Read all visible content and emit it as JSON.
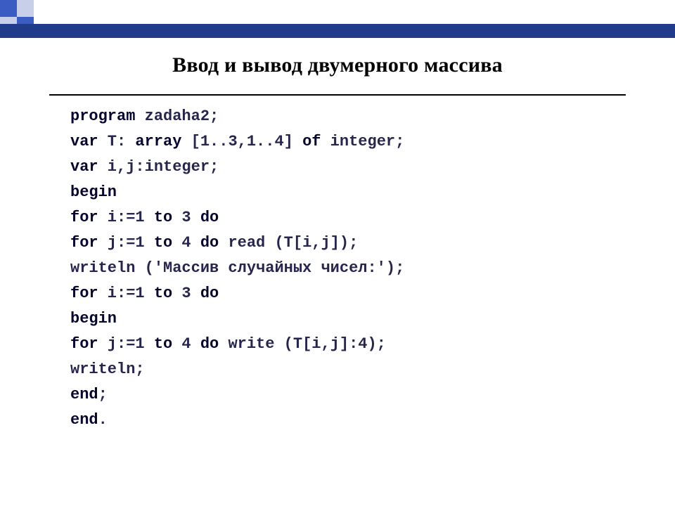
{
  "slide": {
    "title": "Ввод и вывод двумерного массива"
  },
  "code": {
    "lines": [
      {
        "segments": [
          {
            "cls": "kw",
            "text": "program"
          },
          {
            "cls": "id",
            "text": " zadaha2;"
          }
        ]
      },
      {
        "segments": [
          {
            "cls": "kw",
            "text": "var"
          },
          {
            "cls": "id",
            "text": " T: "
          },
          {
            "cls": "kw",
            "text": "array"
          },
          {
            "cls": "id",
            "text": " [1..3,1..4] "
          },
          {
            "cls": "kw",
            "text": "of"
          },
          {
            "cls": "id",
            "text": " integer;"
          }
        ]
      },
      {
        "segments": [
          {
            "cls": "kw",
            "text": "var"
          },
          {
            "cls": "id",
            "text": " i,j:integer;"
          }
        ]
      },
      {
        "segments": [
          {
            "cls": "kw",
            "text": "begin"
          }
        ]
      },
      {
        "segments": [
          {
            "cls": "kw",
            "text": "for"
          },
          {
            "cls": "id",
            "text": " i:=1 "
          },
          {
            "cls": "kw",
            "text": "to"
          },
          {
            "cls": "id",
            "text": " 3 "
          },
          {
            "cls": "kw",
            "text": "do"
          }
        ]
      },
      {
        "segments": [
          {
            "cls": "kw",
            "text": "for"
          },
          {
            "cls": "id",
            "text": " j:=1 "
          },
          {
            "cls": "kw",
            "text": "to"
          },
          {
            "cls": "id",
            "text": " 4 "
          },
          {
            "cls": "kw",
            "text": "do"
          },
          {
            "cls": "id",
            "text": " read (T[i,j]);"
          }
        ]
      },
      {
        "segments": [
          {
            "cls": "id",
            "text": "writeln ('Массив случайных чисел:');"
          }
        ]
      },
      {
        "segments": [
          {
            "cls": "kw",
            "text": "for"
          },
          {
            "cls": "id",
            "text": " i:=1 "
          },
          {
            "cls": "kw",
            "text": "to"
          },
          {
            "cls": "id",
            "text": " 3 "
          },
          {
            "cls": "kw",
            "text": "do"
          }
        ]
      },
      {
        "segments": [
          {
            "cls": "kw",
            "text": "begin"
          }
        ]
      },
      {
        "segments": [
          {
            "cls": "kw",
            "text": "for"
          },
          {
            "cls": "id",
            "text": " j:=1 "
          },
          {
            "cls": "kw",
            "text": "to"
          },
          {
            "cls": "id",
            "text": " 4 "
          },
          {
            "cls": "kw",
            "text": "do"
          },
          {
            "cls": "id",
            "text": " write (T[i,j]:4);"
          }
        ]
      },
      {
        "segments": [
          {
            "cls": "id",
            "text": "writeln;"
          }
        ]
      },
      {
        "segments": [
          {
            "cls": "kw",
            "text": "end"
          },
          {
            "cls": "id",
            "text": ";"
          }
        ]
      },
      {
        "segments": [
          {
            "cls": "kw",
            "text": "end"
          },
          {
            "cls": "id",
            "text": "."
          }
        ]
      }
    ]
  }
}
